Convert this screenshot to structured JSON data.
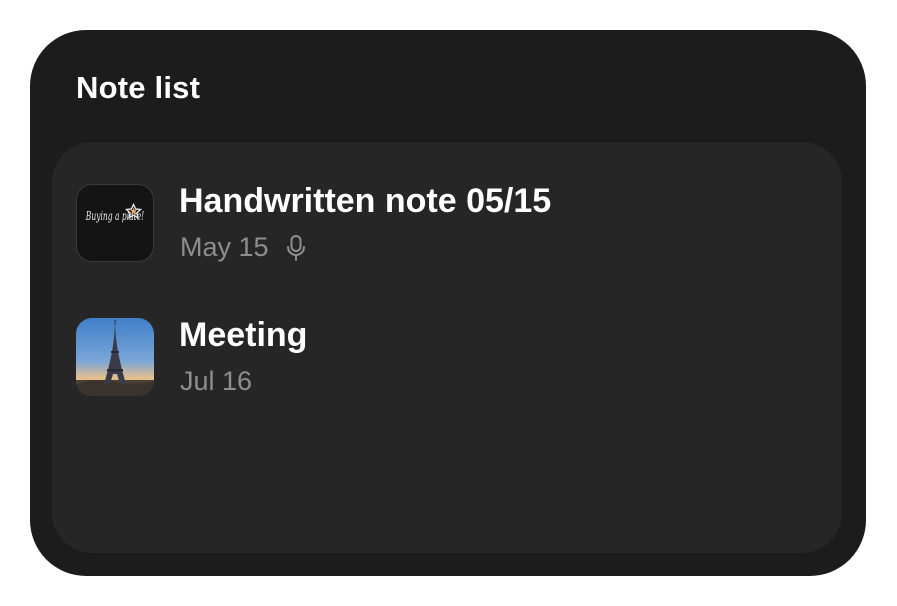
{
  "widget": {
    "title": "Note list"
  },
  "notes": [
    {
      "title": "Handwritten note 05/15",
      "date": "May 15",
      "thumbnail_text": "Buying a plate!",
      "thumbnail_icon": "handwritten-note-thumbnail",
      "has_voice_recording": true,
      "meta_icon": "microphone-icon"
    },
    {
      "title": "Meeting",
      "date": "Jul 16",
      "thumbnail_icon": "eiffel-tower-photo-thumbnail",
      "has_voice_recording": false
    }
  ],
  "colors": {
    "widget_bg": "#1c1c1c",
    "card_bg": "#262626",
    "title_text": "#ffffff",
    "meta_text": "#8e8e8e"
  }
}
